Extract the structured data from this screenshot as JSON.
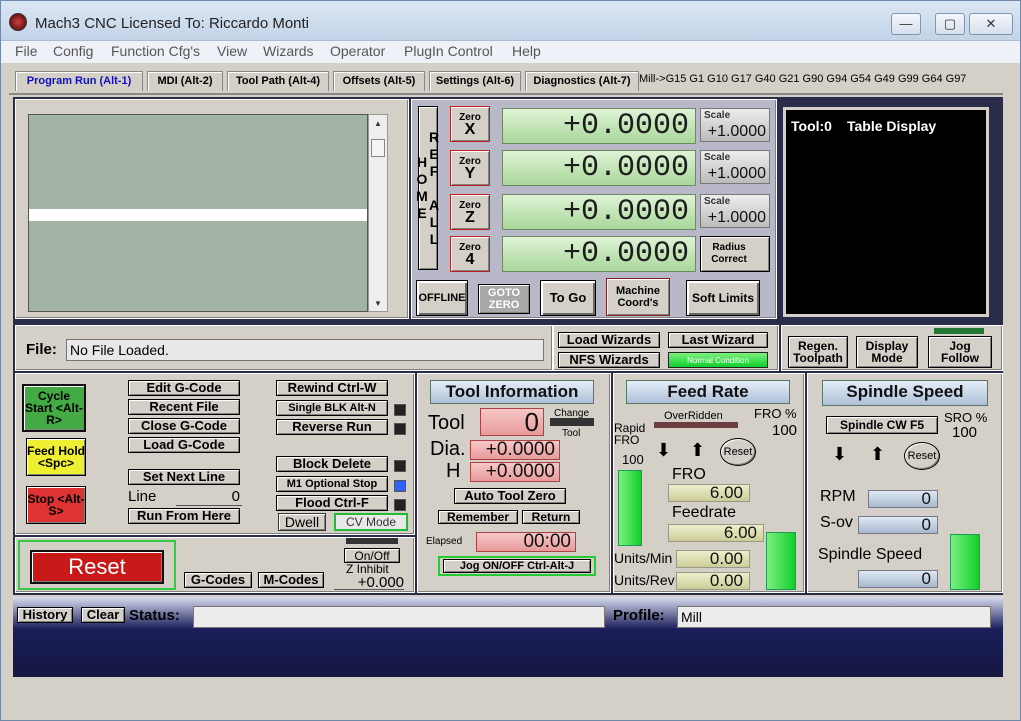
{
  "window": {
    "title": "Mach3 CNC  Licensed To: Riccardo Monti",
    "min": "—",
    "max": "▢",
    "close": "✕"
  },
  "menu": [
    "File",
    "Config",
    "Function Cfg's",
    "View",
    "Wizards",
    "Operator",
    "PlugIn Control",
    "Help"
  ],
  "tabs": [
    "Program Run (Alt-1)",
    "MDI (Alt-2)",
    "Tool Path (Alt-4)",
    "Offsets (Alt-5)",
    "Settings (Alt-6)",
    "Diagnostics (Alt-7)"
  ],
  "modal_line": "Mill->G15  G1 G10 G17 G40 G21 G90 G94 G54 G49 G99 G64 G97",
  "axes": {
    "ref_all_home": "REF ALL HOME",
    "zero_label": "Zero",
    "rows": [
      {
        "axis": "X",
        "value": "+0.0000",
        "scale_label": "Scale",
        "scale": "+1.0000"
      },
      {
        "axis": "Y",
        "value": "+0.0000",
        "scale_label": "Scale",
        "scale": "+1.0000"
      },
      {
        "axis": "Z",
        "value": "+0.0000",
        "scale_label": "Scale",
        "scale": "+1.0000"
      },
      {
        "axis": "4",
        "value": "+0.0000",
        "scale_label": "Radius Correct",
        "scale": ""
      }
    ],
    "offline": "OFFLINE",
    "goto_zero": "GOTO ZERO",
    "to_go": "To Go",
    "machine_coords": "Machine Coord's",
    "soft_limits": "Soft Limits"
  },
  "tool_display": {
    "tool_label": "Tool:0",
    "table_label": "Table Display"
  },
  "file": {
    "label": "File:",
    "value": "No File Loaded."
  },
  "wizards": {
    "load": "Load Wizards",
    "last": "Last Wizard",
    "nfs": "NFS Wizards",
    "normal": "Normal Condition"
  },
  "view_buttons": {
    "regen": "Regen. Toolpath",
    "display": "Display Mode",
    "jog": "Jog Follow"
  },
  "program": {
    "cycle_start": "Cycle Start <Alt-R>",
    "feed_hold": "Feed Hold <Spc>",
    "stop": "Stop <Alt-S>",
    "edit": "Edit G-Code",
    "recent": "Recent File",
    "close": "Close G-Code",
    "load": "Load G-Code",
    "set_next": "Set Next Line",
    "line_label": "Line",
    "line_value": "0",
    "run_from_here": "Run From Here",
    "rewind": "Rewind Ctrl-W",
    "single_blk": "Single BLK Alt-N",
    "reverse_run": "Reverse Run",
    "block_delete": "Block Delete",
    "m1_stop": "M1 Optional Stop",
    "flood": "Flood Ctrl-F",
    "dwell": "Dwell",
    "cv_mode": "CV Mode"
  },
  "reset": {
    "label": "Reset",
    "gcodes": "G-Codes",
    "mcodes": "M-Codes",
    "onoff": "On/Off",
    "z_inhibit": "Z Inhibit",
    "z_value": "+0.000"
  },
  "tool_info": {
    "title": "Tool Information",
    "tool_label": "Tool",
    "tool_value": "0",
    "change": "Change",
    "tool_small": "Tool",
    "dia_label": "Dia.",
    "dia_value": "+0.0000",
    "h_label": "H",
    "h_value": "+0.0000",
    "auto_zero": "Auto Tool Zero",
    "remember": "Remember",
    "return": "Return",
    "elapsed_label": "Elapsed",
    "elapsed_value": "00:00",
    "jog": "Jog ON/OFF Ctrl-Alt-J"
  },
  "feed": {
    "title": "Feed Rate",
    "overridden": "OverRidden",
    "fro_pct_label": "FRO %",
    "fro_pct": "100",
    "rapid": "Rapid FRO",
    "rapid_value": "100",
    "reset": "Reset",
    "fro_label": "FRO",
    "fro_value": "6.00",
    "feedrate_label": "Feedrate",
    "feedrate_value": "6.00",
    "units_min_label": "Units/Min",
    "units_min": "0.00",
    "units_rev_label": "Units/Rev",
    "units_rev": "0.00"
  },
  "spindle": {
    "title": "Spindle Speed",
    "cw": "Spindle CW F5",
    "sro_label": "SRO %",
    "sro_value": "100",
    "reset": "Reset",
    "rpm_label": "RPM",
    "rpm_value": "0",
    "sov_label": "S-ov",
    "sov_value": "0",
    "speed_label": "Spindle Speed",
    "speed_value": "0"
  },
  "status": {
    "history": "History",
    "clear": "Clear",
    "status_label": "Status:",
    "profile_label": "Profile:",
    "profile_value": "Mill"
  }
}
